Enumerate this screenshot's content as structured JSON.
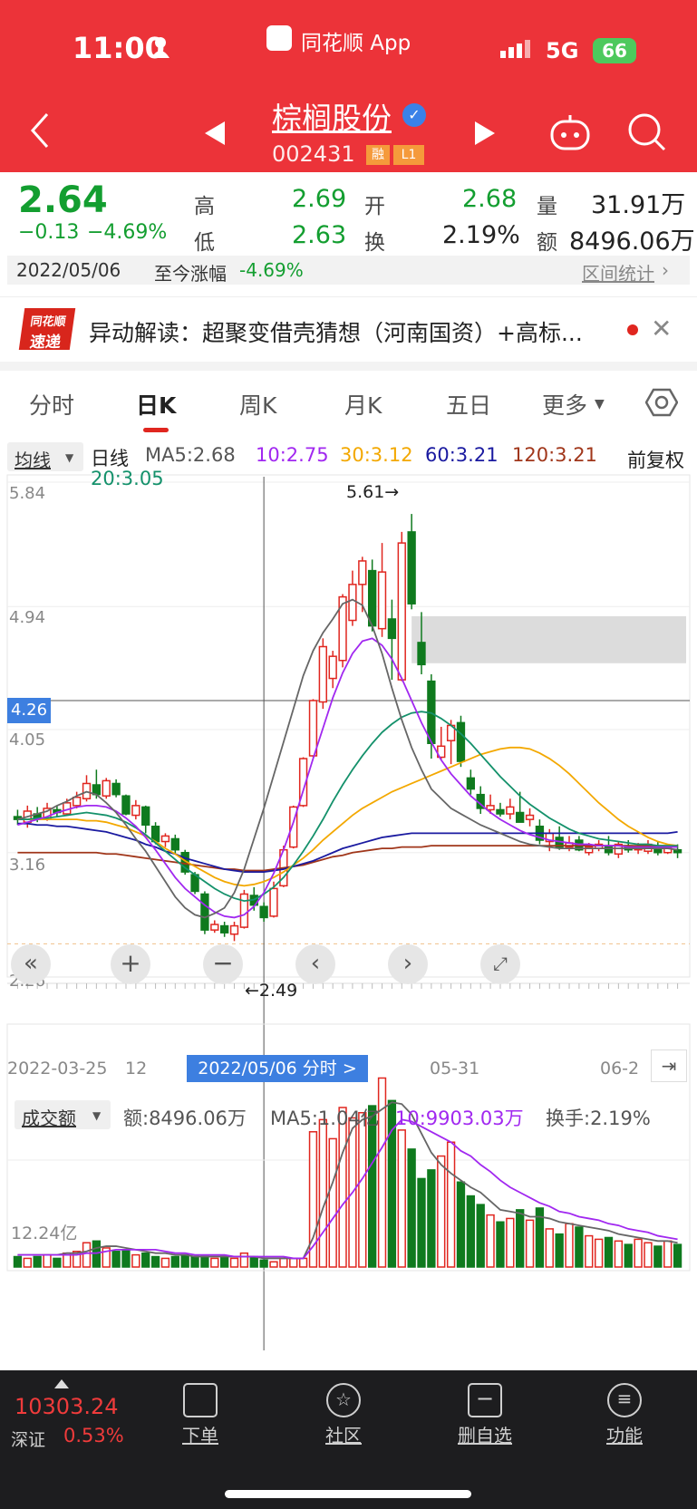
{
  "status": {
    "time": "11:00",
    "app": "同花顺 App",
    "net": "5G",
    "battery": "66"
  },
  "header": {
    "name": "棕榈股份",
    "code": "002431",
    "tag1": "融",
    "tag2": "L1"
  },
  "quote": {
    "price": "2.64",
    "chg": "−0.13",
    "pct": "−4.69%",
    "high_l": "高",
    "high": "2.69",
    "low_l": "低",
    "low": "2.63",
    "open_l": "开",
    "open": "2.68",
    "turn_l": "换",
    "turn": "2.19%",
    "vol_l": "量",
    "vol": "31.91万",
    "amt_l": "额",
    "amt": "8496.06万",
    "date": "2022/05/06",
    "since_l": "至今涨幅",
    "since": "-4.69%",
    "range": "区间统计"
  },
  "news": {
    "logo1": "同花顺",
    "logo2": "速递",
    "text": "异动解读：超聚变借壳猜想（河南国资）+高标..."
  },
  "tabs": [
    "分时",
    "日K",
    "周K",
    "月K",
    "五日",
    "更多"
  ],
  "ma": {
    "btn": "均线",
    "label": "日线",
    "ma5": "MA5:2.68",
    "ma10": "10:2.75",
    "ma30": "30:3.12",
    "ma60": "60:3.21",
    "ma120": "120:3.21",
    "ma20": "20:3.05",
    "right": "前复权"
  },
  "axis": {
    "y1": "5.84",
    "y2": "4.94",
    "y3": "4.05",
    "ycur": "4.26",
    "y4": "3.16",
    "y5": "2.26",
    "hi": "5.61→",
    "lo": "←2.49",
    "d1": "2022-03-25",
    "d1b": "12",
    "sel": "2022/05/06 分时 >",
    "d2": "05-31",
    "d3": "06-2"
  },
  "vol": {
    "btn": "成交额",
    "amt": "额:8496.06万",
    "ma5": "MA5:1.04亿",
    "ma10": "10:9903.03万",
    "turn": "换手:2.19%",
    "ylab": "12.24亿"
  },
  "bottom": {
    "index": "10303.24",
    "mkt": "深证",
    "pct": "0.53%",
    "b1": "下单",
    "b2": "社区",
    "b3": "删自选",
    "b4": "功能"
  },
  "chart_data": {
    "type": "candlestick",
    "ylim": [
      2.26,
      5.84
    ],
    "high": 5.61,
    "low": 2.49,
    "candles": [
      [
        3.42,
        3.4,
        3.47,
        3.36
      ],
      [
        3.38,
        3.46,
        3.5,
        3.34
      ],
      [
        3.44,
        3.41,
        3.49,
        3.38
      ],
      [
        3.4,
        3.48,
        3.52,
        3.39
      ],
      [
        3.47,
        3.45,
        3.5,
        3.42
      ],
      [
        3.44,
        3.52,
        3.55,
        3.43
      ],
      [
        3.5,
        3.56,
        3.6,
        3.48
      ],
      [
        3.55,
        3.66,
        3.72,
        3.53
      ],
      [
        3.65,
        3.58,
        3.76,
        3.55
      ],
      [
        3.57,
        3.68,
        3.7,
        3.55
      ],
      [
        3.66,
        3.58,
        3.69,
        3.56
      ],
      [
        3.57,
        3.44,
        3.58,
        3.43
      ],
      [
        3.43,
        3.5,
        3.54,
        3.4
      ],
      [
        3.49,
        3.36,
        3.5,
        3.3
      ],
      [
        3.35,
        3.24,
        3.38,
        3.22
      ],
      [
        3.24,
        3.28,
        3.3,
        3.2
      ],
      [
        3.26,
        3.18,
        3.29,
        3.15
      ],
      [
        3.16,
        3.02,
        3.18,
        3.0
      ],
      [
        3.0,
        2.88,
        3.02,
        2.86
      ],
      [
        2.86,
        2.6,
        2.88,
        2.57
      ],
      [
        2.6,
        2.64,
        2.67,
        2.58
      ],
      [
        2.63,
        2.58,
        2.66,
        2.55
      ],
      [
        2.57,
        2.63,
        2.66,
        2.52
      ],
      [
        2.62,
        2.86,
        2.89,
        2.61
      ],
      [
        2.85,
        2.78,
        2.91,
        2.74
      ],
      [
        2.77,
        2.69,
        2.8,
        2.66
      ],
      [
        2.7,
        2.9,
        2.95,
        2.69
      ],
      [
        2.92,
        3.18,
        3.21,
        2.91
      ],
      [
        3.2,
        3.49,
        3.5,
        3.19
      ],
      [
        3.5,
        3.84,
        3.85,
        3.49
      ],
      [
        3.86,
        4.26,
        4.27,
        3.85
      ],
      [
        4.25,
        4.65,
        4.71,
        4.2
      ],
      [
        4.42,
        4.58,
        4.62,
        4.35
      ],
      [
        4.55,
        5.01,
        5.03,
        4.5
      ],
      [
        4.84,
        5.1,
        5.2,
        4.8
      ],
      [
        5.1,
        5.27,
        5.3,
        4.9
      ],
      [
        5.2,
        4.8,
        5.28,
        4.76
      ],
      [
        4.78,
        5.19,
        5.4,
        4.72
      ],
      [
        4.85,
        4.71,
        4.99,
        4.41
      ],
      [
        4.41,
        5.4,
        5.48,
        4.4
      ],
      [
        5.48,
        4.96,
        5.61,
        4.92
      ],
      [
        4.68,
        4.52,
        4.9,
        4.45
      ],
      [
        4.4,
        3.95,
        4.45,
        3.84
      ],
      [
        3.85,
        3.93,
        4.07,
        3.83
      ],
      [
        3.97,
        4.08,
        4.12,
        3.8
      ],
      [
        4.1,
        3.82,
        4.15,
        3.78
      ],
      [
        3.7,
        3.62,
        3.76,
        3.58
      ],
      [
        3.58,
        3.48,
        3.64,
        3.44
      ],
      [
        3.47,
        3.5,
        3.58,
        3.44
      ],
      [
        3.47,
        3.44,
        3.52,
        3.42
      ],
      [
        3.44,
        3.49,
        3.55,
        3.4
      ],
      [
        3.45,
        3.38,
        3.6,
        3.38
      ],
      [
        3.4,
        3.43,
        3.48,
        3.35
      ],
      [
        3.35,
        3.25,
        3.4,
        3.22
      ],
      [
        3.24,
        3.3,
        3.33,
        3.17
      ],
      [
        3.27,
        3.2,
        3.35,
        3.18
      ],
      [
        3.2,
        3.23,
        3.28,
        3.17
      ],
      [
        3.25,
        3.18,
        3.28,
        3.17
      ],
      [
        3.16,
        3.2,
        3.23,
        3.14
      ],
      [
        3.19,
        3.22,
        3.25,
        3.17
      ],
      [
        3.2,
        3.16,
        3.28,
        3.14
      ],
      [
        3.15,
        3.22,
        3.24,
        3.12
      ],
      [
        3.21,
        3.18,
        3.25,
        3.16
      ],
      [
        3.18,
        3.2,
        3.23,
        3.15
      ],
      [
        3.17,
        3.22,
        3.25,
        3.15
      ],
      [
        3.2,
        3.16,
        3.24,
        3.14
      ],
      [
        3.16,
        3.19,
        3.2,
        3.15
      ],
      [
        3.18,
        3.16,
        3.22,
        3.12
      ]
    ],
    "ma5": [
      3.4,
      3.42,
      3.44,
      3.46,
      3.5,
      3.53,
      3.57,
      3.6,
      3.58,
      3.52,
      3.45,
      3.36,
      3.26,
      3.17,
      3.06,
      2.95,
      2.84,
      2.76,
      2.71,
      2.69,
      2.72,
      2.76,
      2.87,
      3.04,
      3.26,
      3.48,
      3.72,
      3.96,
      4.2,
      4.44,
      4.62,
      4.75,
      4.85,
      4.96,
      4.99,
      4.95,
      4.8,
      4.6,
      4.35,
      4.12,
      3.92,
      3.76,
      3.62,
      3.55,
      3.48,
      3.44,
      3.4,
      3.36,
      3.33,
      3.3,
      3.27,
      3.24,
      3.22,
      3.21,
      3.2,
      3.19,
      3.19,
      3.19,
      3.19,
      3.19,
      3.19,
      3.19,
      3.19,
      3.19,
      3.19,
      3.19,
      3.19,
      3.18
    ],
    "ma10": [
      3.36,
      3.38,
      3.4,
      3.42,
      3.45,
      3.47,
      3.49,
      3.5,
      3.5,
      3.49,
      3.46,
      3.41,
      3.35,
      3.27,
      3.18,
      3.08,
      2.98,
      2.9,
      2.84,
      2.78,
      2.73,
      2.7,
      2.69,
      2.71,
      2.77,
      2.87,
      3.01,
      3.18,
      3.38,
      3.61,
      3.84,
      4.06,
      4.28,
      4.46,
      4.6,
      4.69,
      4.71,
      4.66,
      4.56,
      4.42,
      4.26,
      4.1,
      3.96,
      3.83,
      3.73,
      3.65,
      3.57,
      3.51,
      3.45,
      3.4,
      3.36,
      3.32,
      3.29,
      3.27,
      3.25,
      3.24,
      3.23,
      3.22,
      3.22,
      3.21,
      3.21,
      3.21,
      3.2,
      3.2,
      3.2,
      3.2,
      3.2,
      3.2
    ],
    "ma20": [
      3.4,
      3.4,
      3.41,
      3.41,
      3.42,
      3.43,
      3.44,
      3.45,
      3.44,
      3.43,
      3.41,
      3.38,
      3.34,
      3.29,
      3.23,
      3.17,
      3.11,
      3.05,
      3.0,
      2.95,
      2.9,
      2.86,
      2.83,
      2.81,
      2.82,
      2.86,
      2.91,
      2.98,
      3.07,
      3.17,
      3.28,
      3.4,
      3.53,
      3.65,
      3.76,
      3.86,
      3.95,
      4.03,
      4.09,
      4.14,
      4.17,
      4.18,
      4.17,
      4.13,
      4.08,
      4.02,
      3.95,
      3.87,
      3.79,
      3.71,
      3.64,
      3.57,
      3.51,
      3.46,
      3.41,
      3.37,
      3.33,
      3.3,
      3.28,
      3.26,
      3.25,
      3.24,
      3.23,
      3.22,
      3.22,
      3.21,
      3.21,
      3.21
    ],
    "ma30": [
      3.4,
      3.4,
      3.4,
      3.4,
      3.4,
      3.4,
      3.4,
      3.39,
      3.39,
      3.38,
      3.36,
      3.34,
      3.31,
      3.28,
      3.24,
      3.19,
      3.15,
      3.1,
      3.06,
      3.02,
      2.98,
      2.95,
      2.93,
      2.92,
      2.93,
      2.95,
      2.98,
      3.02,
      3.07,
      3.12,
      3.18,
      3.25,
      3.31,
      3.37,
      3.43,
      3.48,
      3.52,
      3.56,
      3.6,
      3.63,
      3.66,
      3.69,
      3.72,
      3.75,
      3.78,
      3.81,
      3.84,
      3.87,
      3.89,
      3.91,
      3.92,
      3.92,
      3.91,
      3.88,
      3.84,
      3.79,
      3.73,
      3.66,
      3.59,
      3.52,
      3.46,
      3.4,
      3.35,
      3.31,
      3.27,
      3.24,
      3.22,
      3.21
    ],
    "ma60": [
      3.37,
      3.37,
      3.36,
      3.36,
      3.35,
      3.35,
      3.34,
      3.33,
      3.32,
      3.31,
      3.29,
      3.27,
      3.25,
      3.22,
      3.2,
      3.17,
      3.15,
      3.12,
      3.1,
      3.08,
      3.06,
      3.04,
      3.03,
      3.02,
      3.02,
      3.02,
      3.03,
      3.04,
      3.06,
      3.08,
      3.1,
      3.13,
      3.16,
      3.19,
      3.21,
      3.23,
      3.25,
      3.27,
      3.28,
      3.29,
      3.3,
      3.3,
      3.3,
      3.3,
      3.3,
      3.3,
      3.3,
      3.3,
      3.3,
      3.3,
      3.3,
      3.3,
      3.3,
      3.3,
      3.3,
      3.3,
      3.3,
      3.3,
      3.3,
      3.3,
      3.3,
      3.3,
      3.3,
      3.3,
      3.3,
      3.3,
      3.3,
      3.31
    ],
    "ma120": [
      3.16,
      3.16,
      3.16,
      3.16,
      3.16,
      3.16,
      3.16,
      3.16,
      3.16,
      3.15,
      3.15,
      3.14,
      3.13,
      3.12,
      3.11,
      3.1,
      3.09,
      3.08,
      3.07,
      3.06,
      3.05,
      3.04,
      3.04,
      3.03,
      3.03,
      3.03,
      3.04,
      3.05,
      3.06,
      3.07,
      3.09,
      3.11,
      3.13,
      3.14,
      3.16,
      3.17,
      3.18,
      3.19,
      3.19,
      3.2,
      3.2,
      3.2,
      3.21,
      3.21,
      3.21,
      3.21,
      3.21,
      3.21,
      3.21,
      3.21,
      3.21,
      3.21,
      3.21,
      3.21,
      3.21,
      3.21,
      3.21,
      3.21,
      3.21,
      3.21,
      3.21,
      3.21,
      3.21,
      3.21,
      3.21,
      3.21,
      3.21,
      3.21
    ],
    "volume": [
      0.6,
      0.5,
      0.6,
      0.7,
      0.5,
      0.8,
      0.9,
      1.4,
      1.5,
      1.1,
      0.9,
      1.0,
      0.7,
      0.8,
      0.6,
      0.5,
      0.6,
      0.7,
      0.6,
      0.6,
      0.5,
      0.6,
      0.5,
      0.8,
      0.6,
      0.4,
      0.3,
      0.5,
      0.5,
      0.5,
      7.8,
      8.5,
      7.4,
      9.2,
      8.6,
      8.9,
      9.3,
      10.9,
      9.6,
      7.9,
      6.8,
      5.1,
      5.6,
      6.4,
      7.2,
      4.9,
      4.1,
      3.6,
      3.0,
      2.6,
      2.8,
      3.3,
      2.7,
      3.4,
      2.2,
      1.9,
      2.5,
      2.3,
      1.8,
      1.6,
      1.7,
      1.5,
      1.3,
      1.6,
      1.4,
      1.2,
      1.5,
      1.3
    ],
    "vol_ma5": [
      0.7,
      0.7,
      0.7,
      0.7,
      0.7,
      0.8,
      0.8,
      0.9,
      1.1,
      1.2,
      1.2,
      1.1,
      1.0,
      0.9,
      0.8,
      0.8,
      0.7,
      0.7,
      0.6,
      0.6,
      0.6,
      0.6,
      0.6,
      0.6,
      0.6,
      0.5,
      0.5,
      0.5,
      0.5,
      0.5,
      1.7,
      3.4,
      4.9,
      6.6,
      8.0,
      8.5,
      8.7,
      9.1,
      9.5,
      9.4,
      8.8,
      7.7,
      6.6,
      5.9,
      5.4,
      5.0,
      4.6,
      4.3,
      3.8,
      3.3,
      3.2,
      3.1,
      2.9,
      2.9,
      2.8,
      2.6,
      2.5,
      2.4,
      2.3,
      2.2,
      2.1,
      1.9,
      1.8,
      1.7,
      1.6,
      1.5,
      1.5,
      1.4
    ],
    "vol_ma10": [
      0.7,
      0.7,
      0.7,
      0.7,
      0.7,
      0.7,
      0.7,
      0.8,
      0.8,
      0.9,
      1.0,
      1.0,
      1.0,
      1.0,
      1.0,
      0.9,
      0.8,
      0.8,
      0.7,
      0.7,
      0.7,
      0.7,
      0.6,
      0.6,
      0.6,
      0.6,
      0.6,
      0.6,
      0.5,
      0.5,
      1.2,
      2.0,
      2.8,
      3.6,
      4.3,
      5.1,
      6.0,
      6.9,
      7.9,
      8.5,
      8.4,
      8.1,
      7.8,
      7.5,
      7.2,
      6.7,
      6.4,
      5.9,
      5.5,
      5.0,
      4.6,
      4.3,
      4.0,
      3.7,
      3.5,
      3.2,
      3.1,
      2.9,
      2.8,
      2.7,
      2.5,
      2.4,
      2.2,
      2.1,
      2.0,
      1.8,
      1.7,
      1.6
    ]
  }
}
